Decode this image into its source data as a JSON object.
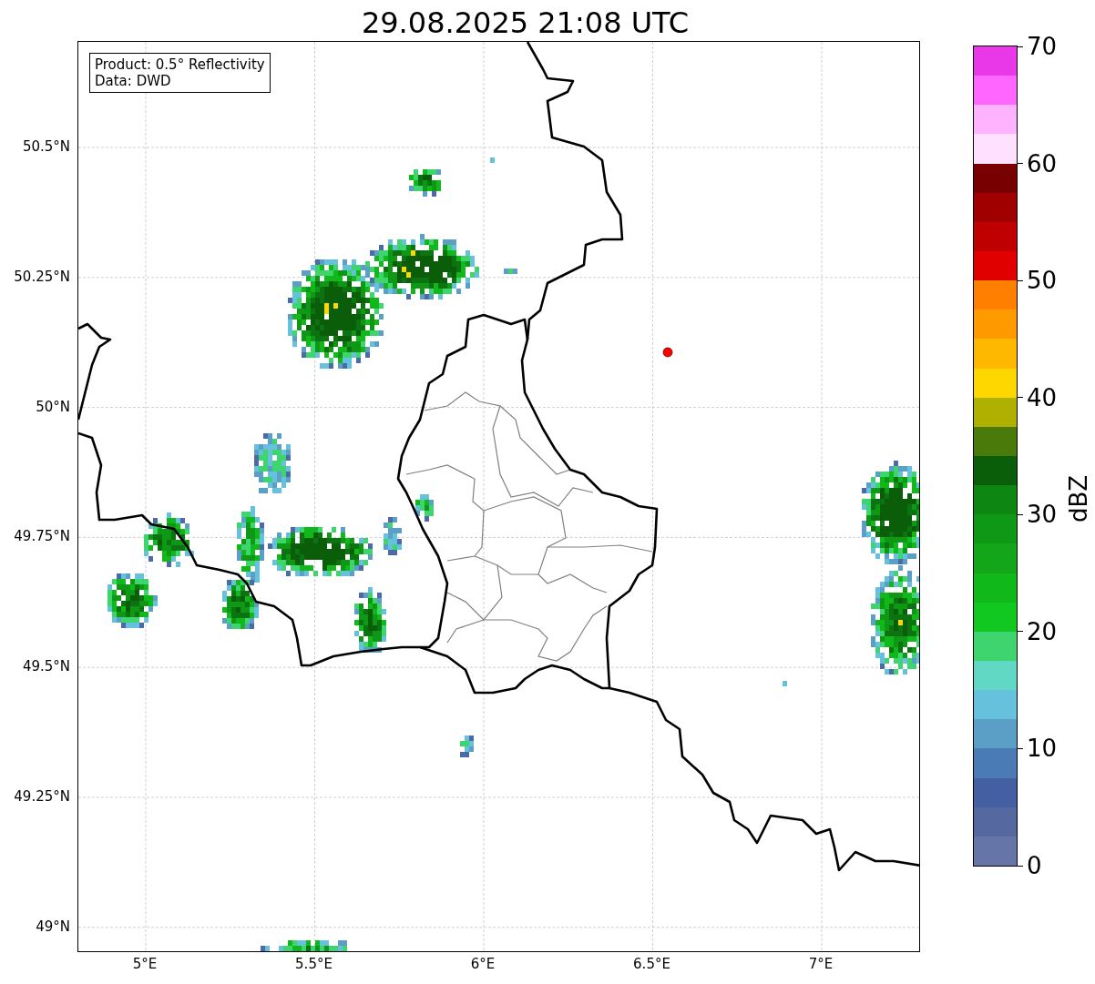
{
  "title": "29.08.2025 21:08 UTC",
  "info_box": [
    "Product: 0.5° Reflectivity",
    "Data: DWD"
  ],
  "lat_ticks": [
    "50.5°N",
    "50.25°N",
    "50°N",
    "49.75°N",
    "49.5°N",
    "49.25°N",
    "49°N"
  ],
  "lon_ticks": [
    "5°E",
    "5.5°E",
    "6°E",
    "6.5°E",
    "7°E"
  ],
  "colorbar": {
    "label": "dBZ",
    "ticks": [
      "70",
      "60",
      "50",
      "40",
      "30",
      "20",
      "10",
      "0"
    ],
    "segments": [
      {
        "color": "#6675a8"
      },
      {
        "color": "#5668a0"
      },
      {
        "color": "#445fa2"
      },
      {
        "color": "#4a7bb4"
      },
      {
        "color": "#5c9fc6"
      },
      {
        "color": "#66c2dc"
      },
      {
        "color": "#60d8c4"
      },
      {
        "color": "#3ed46e"
      },
      {
        "color": "#10c820"
      },
      {
        "color": "#10b81a"
      },
      {
        "color": "#12a618"
      },
      {
        "color": "#0f9816"
      },
      {
        "color": "#0d8612"
      },
      {
        "color": "#0a5e0a"
      },
      {
        "color": "#4a7a0a"
      },
      {
        "color": "#b0b000"
      },
      {
        "color": "#ffd700"
      },
      {
        "color": "#ffb800"
      },
      {
        "color": "#ff9900"
      },
      {
        "color": "#ff7f00"
      },
      {
        "color": "#e00000"
      },
      {
        "color": "#c00000"
      },
      {
        "color": "#a00000"
      },
      {
        "color": "#780000"
      },
      {
        "color": "#ffe0ff"
      },
      {
        "color": "#ffb3ff"
      },
      {
        "color": "#ff66ff"
      },
      {
        "color": "#e838e8"
      }
    ]
  }
}
